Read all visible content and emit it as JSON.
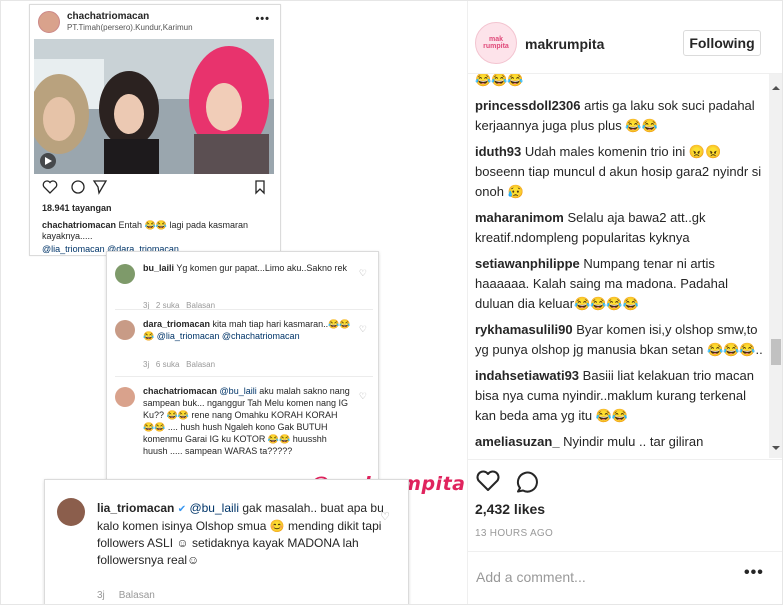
{
  "post_screenshot": {
    "username": "chachatriomacan",
    "location": "PT.Timah(persero).Kundur,Karimun",
    "views": "18.941 tayangan",
    "caption_user": "chachatriomacan",
    "caption_text": "Entah 😂😂 lagi pada kasmaran kayaknya.....",
    "caption_tags": "@lia_triomacan @dara_triomacan"
  },
  "comment_screenshot": {
    "comments": [
      {
        "user": "bu_laili",
        "text": "Yg komen gur papat...Limo aku..Sakno rek",
        "meta_time": "3j",
        "meta_likes": "2 suka",
        "meta_reply": "Balasan"
      },
      {
        "user": "dara_triomacan",
        "text": "kita mah tiap hari kasmaran..😂😂😂",
        "mention": "@lia_triomacan @chachatriomacan",
        "meta_time": "3j",
        "meta_likes": "6 suka",
        "meta_reply": "Balasan"
      },
      {
        "user": "chachatriomacan",
        "mention": "@bu_laili",
        "text": "aku malah sakno nang sampean buk... nganggur Tah Melu komen nang IG Ku?? 😂😂 rene nang Omahku KORAH KORAH 😂😂 .... hush hush Ngaleh kono Gak BUTUH komenmu Garai IG ku KOTOR 😂😂 huusshh huush ..... sampean WARAS ta?????"
      }
    ]
  },
  "watermark": "@makrumpita",
  "big_comment": {
    "user": "lia_triomacan",
    "mention": "@bu_laili",
    "text": "gak masalah.. buat apa bu kalo komen isinya Olshop smua 😊 mending dikit tapi followers ASLI ☺ setidaknya kayak MADONA lah followersnya real☺",
    "meta_time": "3j",
    "meta_reply": "Balasan"
  },
  "panel": {
    "account": "makrumpita",
    "logo_text": "mak rumpita",
    "follow_label": "Following",
    "comments": [
      {
        "user": "",
        "text": "😂😂😂"
      },
      {
        "user": "princessdoll2306",
        "text": "artis ga laku sok suci padahal kerjaannya juga plus plus 😂😂"
      },
      {
        "user": "iduth93",
        "text": "Udah males komenin trio ini 😠😠 boseenn tiap muncul d akun hosip gara2 nyindr si onoh 😥"
      },
      {
        "user": "maharanimom",
        "text": "Selalu aja bawa2 att..gk kreatif.ndompleng popularitas kyknya"
      },
      {
        "user": "setiawanphilippe",
        "text": "Numpang tenar ni artis haaaaaa. Kalah saing ma madona. Padahal duluan dia keluar😂😂😂😂"
      },
      {
        "user": "rykhamasulili90",
        "text": "Byar komen isi,y olshop smw,to yg punya olshop jg manusia bkan setan 😂😂😂.."
      },
      {
        "user": "indahsetiawati93",
        "text": "Basiii liat kelakuan trio macan bisa nya cuma nyindir..maklum kurang terkenal kan beda ama yg itu 😂😂"
      },
      {
        "user": "ameliasuzan_",
        "text": "Nyindir mulu .. tar giliran"
      }
    ],
    "likes": "2,432 likes",
    "time": "13 HOURS AGO",
    "add_comment_placeholder": "Add a comment...",
    "more_label": "•••"
  },
  "colors": {
    "watermark": "#e0245e",
    "mention": "#003569",
    "muted": "#999999"
  }
}
